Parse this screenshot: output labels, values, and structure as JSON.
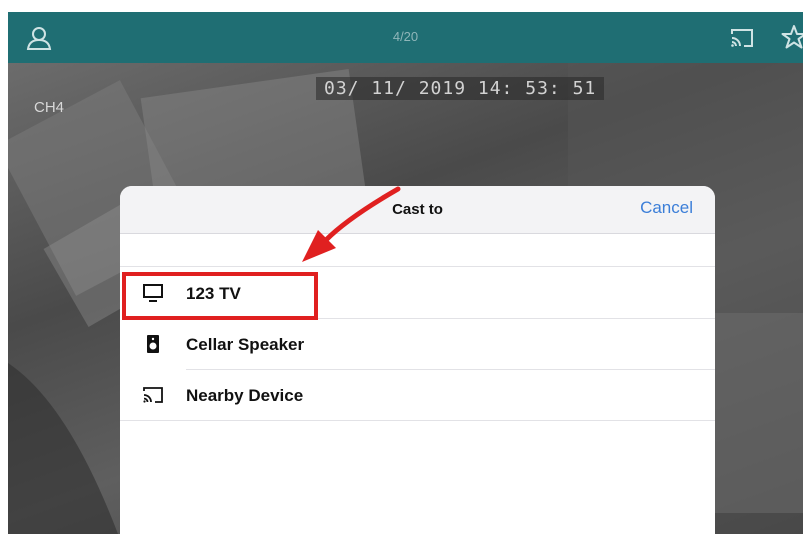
{
  "topbar": {
    "counter": "4/20",
    "icons": {
      "user": "user-icon",
      "cast": "cast-icon",
      "favorite": "star-icon"
    },
    "color": "#1f6e73"
  },
  "camera": {
    "timestamp": "03/ 11/ 2019  14: 53: 51",
    "channel": "CH4"
  },
  "sheet": {
    "title": "Cast to",
    "cancel_label": "Cancel",
    "devices": [
      {
        "label": "123 TV",
        "icon": "tv-icon"
      },
      {
        "label": "Cellar Speaker",
        "icon": "speaker-icon"
      },
      {
        "label": "Nearby Device",
        "icon": "cast-icon"
      }
    ]
  },
  "annotation": {
    "color": "#e02020"
  },
  "accent_color": "#3b7ed8"
}
